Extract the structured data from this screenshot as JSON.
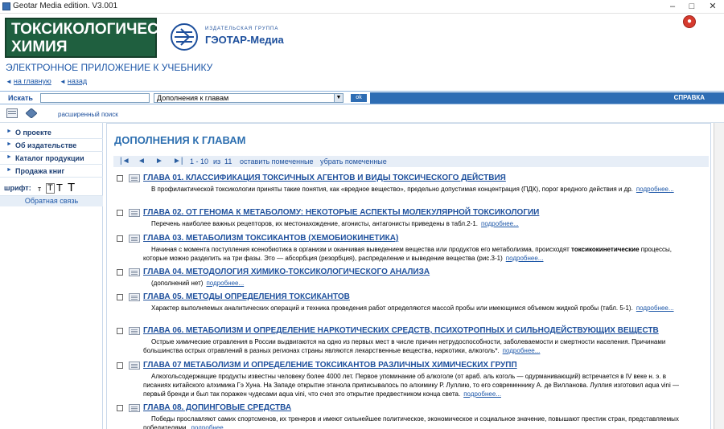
{
  "window": {
    "title": "Geotar Media edition. V3.001"
  },
  "header": {
    "logo_line1": "ТОКСИКОЛОГИЧЕСКАЯ",
    "logo_line2": "ХИМИЯ",
    "publisher_small": "ИЗДАТЕЛЬСКАЯ ГРУППА",
    "publisher_name": "ГЭОТАР-Медиа",
    "subtitle": "ЭЛЕКТРОННОЕ ПРИЛОЖЕНИЕ К УЧЕБНИКУ",
    "nav_home": "на главную",
    "nav_back": "назад"
  },
  "search": {
    "label": "Искать",
    "value": "",
    "category": "Дополнения к главам",
    "ok_label": "ok",
    "help_label": "СПРАВКА",
    "advanced_label": "расширенный поиск"
  },
  "sidebar": {
    "items": [
      {
        "label": "О проекте"
      },
      {
        "label": "Об издательстве"
      },
      {
        "label": "Каталог продукции"
      },
      {
        "label": "Продажа книг"
      }
    ],
    "font_label": "шрифт:",
    "font_sizes": [
      "т",
      "T",
      "T",
      "T"
    ],
    "feedback": "Обратная связь"
  },
  "main": {
    "title": "ДОПОЛНЕНИЯ К ГЛАВАМ",
    "pager": {
      "range": "1 - 10",
      "of": "из",
      "total": "11",
      "keep_marked": "оставить помеченные",
      "remove_marked": "убрать помеченные"
    },
    "more_label": "подробнее...",
    "chapters": [
      {
        "title": "ГЛАВА 01. КЛАССИФИКАЦИЯ ТОКСИЧНЫХ АГЕНТОВ И ВИДЫ ТОКСИЧЕСКОГО ДЕЙСТВИЯ",
        "desc": "В профилактической токсикологии приняты такие понятия, как «вредное вещество», предельно допустимая концентрация (ПДК), порог вредного действия и др."
      },
      {
        "title": "ГЛАВА 02. ОТ ГЕНОМА К МЕТАБОЛОМУ: НЕКОТОРЫЕ АСПЕКТЫ МОЛЕКУЛЯРНОЙ ТОКСИКОЛОГИИ",
        "desc": "Перечень наиболее важных рецепторов, их местонахождение, агонисты, антагонисты приведены в табл.2-1."
      },
      {
        "title": "ГЛАВА 03. МЕТАБОЛИЗМ ТОКСИКАНТОВ (ХЕМОБИОКИНЕТИКА)",
        "desc_pre": "Начиная с момента поступления ксенобиотика в организм и оканчивая выведением вещества или продуктов его метаболизма, происходят ",
        "desc_bold": "токсикокинетические",
        "desc_post": " процессы, которые можно разделить на три фазы. Это — абсорбция (резорбция), распределение и выведение вещества (рис.3-1)"
      },
      {
        "title": "ГЛАВА 04. МЕТОДОЛОГИЯ ХИМИКО-ТОКСИКОЛОГИЧЕСКОГО АНАЛИЗА",
        "desc": "(дополнений нет)"
      },
      {
        "title": "ГЛАВА 05. МЕТОДЫ ОПРЕДЕЛЕНИЯ ТОКСИКАНТОВ",
        "desc": "Характер выполняемых аналитических операций и техника проведения работ определяются массой пробы или имеющимся объемом жидкой пробы (табл. 5-1)."
      },
      {
        "title": "ГЛАВА 06. МЕТАБОЛИЗМ И ОПРЕДЕЛЕНИЕ НАРКОТИЧЕСКИХ СРЕДСТВ, ПСИХОТРОПНЫХ И СИЛЬНОДЕЙСТВУЮЩИХ ВЕЩЕСТВ",
        "desc": "Острые химические отравления в России выдвигаются на одно из первых мест в числе причин нетрудоспособности, заболеваемости и смертности населения. Причинами большинства острых отравлений в разных регионах страны являются лекарственные вещества, наркотики, алкоголь*."
      },
      {
        "title": "ГЛАВА 07 МЕТАБОЛИЗМ И ОПРЕДЕЛЕНИЕ ТОКСИКАНТОВ РАЗЛИЧНЫХ ХИМИЧЕСКИХ ГРУПП",
        "desc": "Алкогольсодержащие продукты известны человеку более 4000 лет. Первое упоминание об алкоголе (от араб. аль коголь — одурманивающий) встречается в IV веке н. э. в писаниях китайского алхимика Гэ Хуна. На Западе открытие этанола приписывалось по алхимику Р. Луллию, то его современнику А. де Вилланова. Луллия изготовил aqua vini — первый бренди и был так поражен чудесами aqua vini, что счел это открытие предвестником конца света."
      },
      {
        "title": "ГЛАВА 08. ДОПИНГОВЫЕ СРЕДСТВА",
        "desc": "Победы прославляют самих спортсменов, их тренеров и имеют сильнейшее политическое, экономическое и социальное значение, повышают престиж стран, представляемых победителями."
      }
    ]
  },
  "colors": {
    "accent": "#1d57a8",
    "logo_bg": "#1f5f3f",
    "bar_blue": "#2e6db4"
  }
}
